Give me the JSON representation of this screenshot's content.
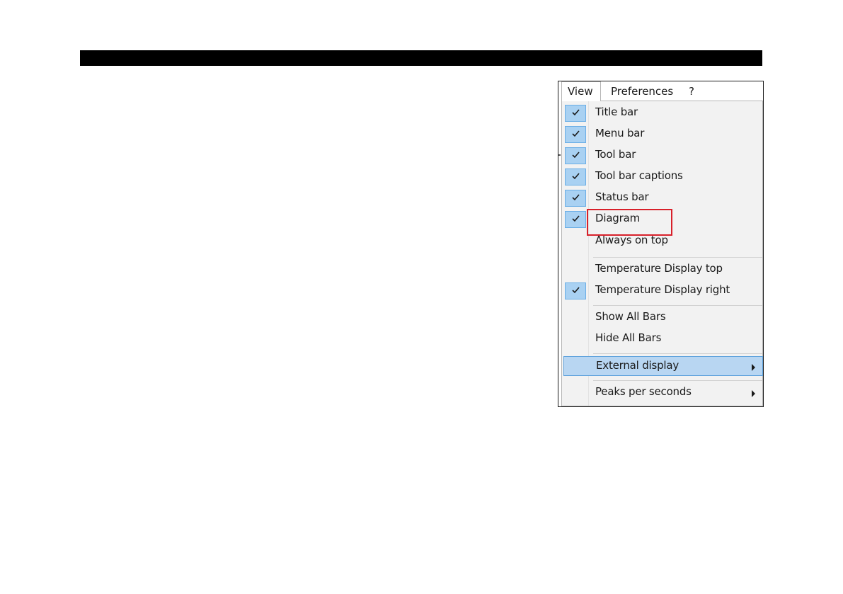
{
  "menubar": {
    "items": [
      "View",
      "Preferences",
      "?"
    ]
  },
  "view_menu": {
    "items": [
      {
        "label": "Title bar",
        "checked": true
      },
      {
        "label": "Menu bar",
        "checked": true
      },
      {
        "label": "Tool bar",
        "checked": true
      },
      {
        "label": "Tool bar captions",
        "checked": true
      },
      {
        "label": "Status bar",
        "checked": true
      },
      {
        "label": "Diagram",
        "checked": true
      },
      {
        "label": "Always on top",
        "checked": false,
        "annotated": true
      },
      {
        "label": "Temperature Display top",
        "checked": false
      },
      {
        "label": "Temperature Display right",
        "checked": true
      },
      {
        "label": "Show All Bars",
        "checked": false
      },
      {
        "label": "Hide All Bars",
        "checked": false
      },
      {
        "label": "External display",
        "checked": false,
        "submenu": true,
        "highlighted": true
      },
      {
        "label": "Peaks per seconds",
        "checked": false,
        "submenu": true
      }
    ]
  },
  "colors": {
    "check_fill": "#a9d1f2",
    "highlight_fill": "#b8d6f2",
    "annotation": "#d8202a",
    "menu_background": "#f2f2f2"
  }
}
